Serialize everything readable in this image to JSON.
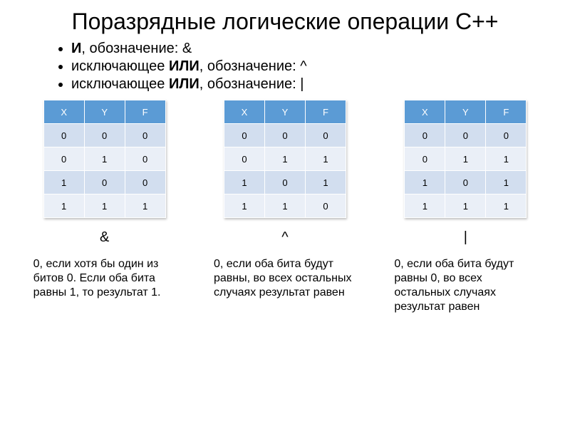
{
  "title": "Поразрядные логические операции C++",
  "bullets": [
    {
      "strong": "И",
      "rest": ", обозначение: &"
    },
    {
      "strong": "",
      "pre": "исключающее ",
      "mid": "ИЛИ",
      "rest": ", обозначение:  ^"
    },
    {
      "strong": "",
      "pre": "исключающее ",
      "mid": "ИЛИ",
      "rest": ", обозначение:  |"
    }
  ],
  "headers": [
    "X",
    "Y",
    "F"
  ],
  "tables": {
    "and": [
      [
        0,
        0,
        0
      ],
      [
        0,
        1,
        0
      ],
      [
        1,
        0,
        0
      ],
      [
        1,
        1,
        1
      ]
    ],
    "xor": [
      [
        0,
        0,
        0
      ],
      [
        0,
        1,
        1
      ],
      [
        1,
        0,
        1
      ],
      [
        1,
        1,
        0
      ]
    ],
    "or": [
      [
        0,
        0,
        0
      ],
      [
        0,
        1,
        1
      ],
      [
        1,
        0,
        1
      ],
      [
        1,
        1,
        1
      ]
    ]
  },
  "symbols": {
    "and": "&",
    "xor": "^",
    "or": "|"
  },
  "descriptions": {
    "and": "0, если хотя бы один из битов 0. Если оба бита равны 1, то результат 1.",
    "xor": "0, если оба бита будут равны, во всех остальных случаях результат равен",
    "or": "0, если оба бита будут равны 0, во всех остальных случаях результат равен"
  },
  "chart_data": [
    {
      "type": "table",
      "title": "AND (&)",
      "columns": [
        "X",
        "Y",
        "F"
      ],
      "rows": [
        [
          0,
          0,
          0
        ],
        [
          0,
          1,
          0
        ],
        [
          1,
          0,
          0
        ],
        [
          1,
          1,
          1
        ]
      ]
    },
    {
      "type": "table",
      "title": "XOR (^)",
      "columns": [
        "X",
        "Y",
        "F"
      ],
      "rows": [
        [
          0,
          0,
          0
        ],
        [
          0,
          1,
          1
        ],
        [
          1,
          0,
          1
        ],
        [
          1,
          1,
          0
        ]
      ]
    },
    {
      "type": "table",
      "title": "OR (|)",
      "columns": [
        "X",
        "Y",
        "F"
      ],
      "rows": [
        [
          0,
          0,
          0
        ],
        [
          0,
          1,
          1
        ],
        [
          1,
          0,
          1
        ],
        [
          1,
          1,
          1
        ]
      ]
    }
  ]
}
